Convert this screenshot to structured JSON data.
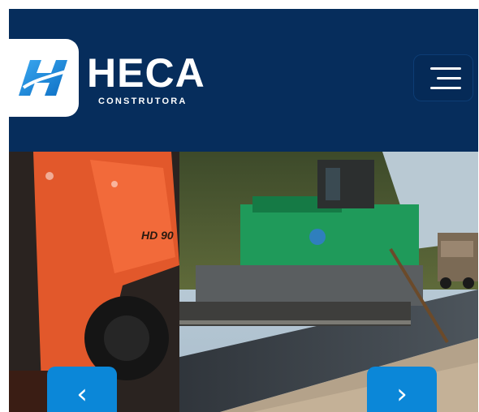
{
  "header": {
    "brand_name": "HECA",
    "brand_tagline": "CONSTRUTORA",
    "logo_icon": "heca-h-logo-icon",
    "menu_icon": "hamburger-menu-icon"
  },
  "hero": {
    "slide_image": "road-paving-machinery-image",
    "roller_marking": "HD 90",
    "prev_label": "‹",
    "next_label": "›"
  },
  "colors": {
    "header_bg": "#062d5c",
    "accent_blue": "#0b87d8",
    "logo_blue": "#1a8fe0"
  }
}
